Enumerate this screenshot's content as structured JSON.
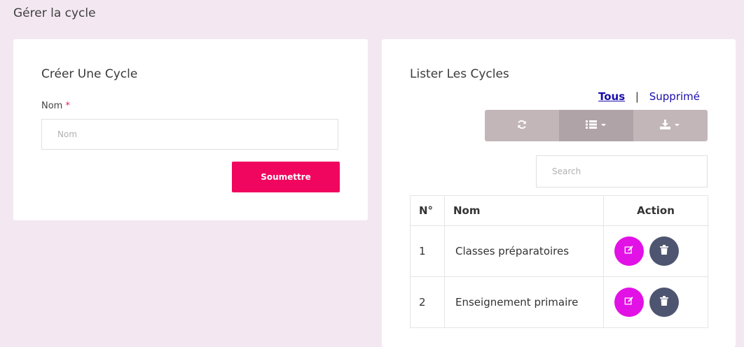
{
  "page": {
    "title": "Gérer la cycle"
  },
  "create_form": {
    "title": "Créer Une Cycle",
    "field_label": "Nom",
    "required_mark": "*",
    "field_placeholder": "Nom",
    "field_value": "",
    "submit_label": "Soumettre"
  },
  "list": {
    "title": "Lister Les Cycles",
    "filters": {
      "all": "Tous",
      "separator": "|",
      "deleted": "Supprimé"
    },
    "toolbar": {
      "buttons": [
        "refresh-icon",
        "columns-icon",
        "download-icon"
      ]
    },
    "search": {
      "placeholder": "Search",
      "value": ""
    },
    "table": {
      "headers": {
        "num": "N°",
        "name": "Nom",
        "action": "Action"
      },
      "rows": [
        {
          "num": "1",
          "name": "Classes préparatoires"
        },
        {
          "num": "2",
          "name": "Enseignement primaire"
        }
      ]
    }
  },
  "colors": {
    "background": "#f3e8f1",
    "submit": "#f0055f",
    "edit": "#e211e6",
    "delete": "#4e5570",
    "toolbar": "#c2b6b9",
    "link": "#1a0dab"
  }
}
